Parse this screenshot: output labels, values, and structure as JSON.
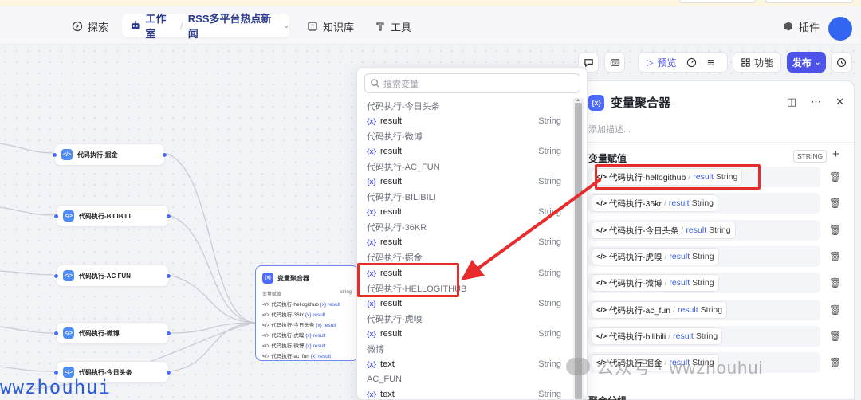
{
  "header": {
    "explore": "探索",
    "studio": "工作室",
    "project": "RSS多平台热点新闻",
    "knowledge": "知识库",
    "tools": "工具",
    "plugin": "插件"
  },
  "toolbar": {
    "preview": "预览",
    "features": "功能",
    "publish": "发布"
  },
  "canvas": {
    "nodes": [
      "代码执行-掘金",
      "代码执行-BILIBILI",
      "代码执行-AC FUN",
      "代码执行-微博",
      "代码执行-今日头条"
    ],
    "aggregator": {
      "title": "变量聚合器",
      "sub_label": "变量赋值",
      "sub_type": "string",
      "rows": [
        {
          "src": "代码执行-hellogithub",
          "var": "result"
        },
        {
          "src": "代码执行-36kr",
          "var": "result"
        },
        {
          "src": "代码执行-今日头条",
          "var": "result"
        },
        {
          "src": "代码执行-虎嗅",
          "var": "result"
        },
        {
          "src": "代码执行-微博",
          "var": "result"
        },
        {
          "src": "代码执行-ac_fun",
          "var": "result"
        }
      ]
    }
  },
  "picker": {
    "search_placeholder": "搜索变量",
    "items": [
      {
        "kind": "group",
        "label": "代码执行-今日头条"
      },
      {
        "kind": "var",
        "label": "result",
        "type": "String"
      },
      {
        "kind": "group",
        "label": "代码执行-微博"
      },
      {
        "kind": "var",
        "label": "result",
        "type": "String"
      },
      {
        "kind": "group",
        "label": "代码执行-AC_FUN"
      },
      {
        "kind": "var",
        "label": "result",
        "type": "String"
      },
      {
        "kind": "group",
        "label": "代码执行-BILIBILI"
      },
      {
        "kind": "var",
        "label": "result",
        "type": "String"
      },
      {
        "kind": "group",
        "label": "代码执行-36KR"
      },
      {
        "kind": "var",
        "label": "result",
        "type": "String"
      },
      {
        "kind": "group",
        "label": "代码执行-掘金"
      },
      {
        "kind": "var",
        "label": "result",
        "type": "String"
      },
      {
        "kind": "group",
        "label": "代码执行-HELLOGITHUB"
      },
      {
        "kind": "var",
        "label": "result",
        "type": "String"
      },
      {
        "kind": "group",
        "label": "代码执行-虎嗅"
      },
      {
        "kind": "var",
        "label": "result",
        "type": "String"
      },
      {
        "kind": "group",
        "label": "微博"
      },
      {
        "kind": "var",
        "label": "text",
        "type": "String"
      },
      {
        "kind": "group",
        "label": "AC_FUN"
      },
      {
        "kind": "var",
        "label": "text",
        "type": "String"
      }
    ]
  },
  "panel": {
    "title": "变量聚合器",
    "desc_placeholder": "添加描述...",
    "section": "变量赋值",
    "type": "STRING",
    "slash": "/",
    "rows": [
      {
        "src": "代码执行-hellogithub",
        "var": "result",
        "type": "String"
      },
      {
        "src": "代码执行-36kr",
        "var": "result",
        "type": "String"
      },
      {
        "src": "代码执行-今日头条",
        "var": "result",
        "type": "String"
      },
      {
        "src": "代码执行-虎嗅",
        "var": "result",
        "type": "String"
      },
      {
        "src": "代码执行-微博",
        "var": "result",
        "type": "String"
      },
      {
        "src": "代码执行-ac_fun",
        "var": "result",
        "type": "String"
      },
      {
        "src": "代码执行-bilibili",
        "var": "result",
        "type": "String"
      },
      {
        "src": "代码执行-掘金",
        "var": "result",
        "type": "String"
      }
    ],
    "footer": "聚合分组"
  },
  "watermarks": {
    "wechat": "公众号 · wwzhouhui",
    "corner": "wwzhouhui"
  },
  "colors": {
    "accent": "#4d53e8",
    "annotation": "#e82c2c",
    "node_icon": "#4d8bf5"
  }
}
